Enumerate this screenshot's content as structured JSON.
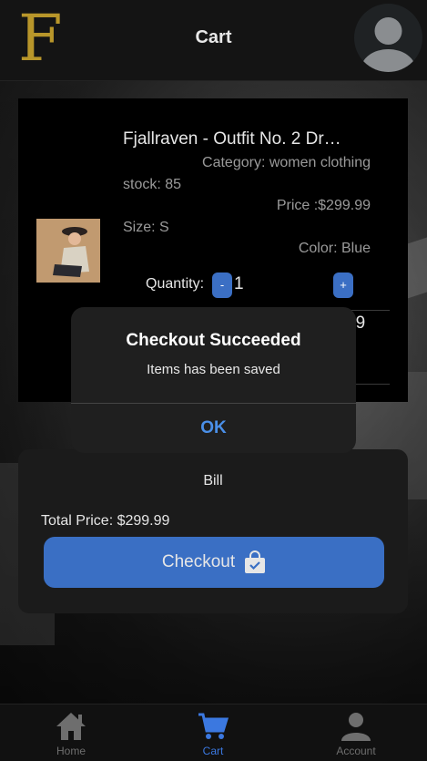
{
  "header": {
    "logo_letter": "F",
    "title": "Cart"
  },
  "product": {
    "title": "Fjallraven - Outfit No. 2 Dr…",
    "category": "Category: women clothing",
    "stock": "stock: 85",
    "price": "Price :$299.99",
    "size": "Size: S",
    "color": "Color: Blue",
    "quantity_label": "Quantity:",
    "quantity_value": "1",
    "decrement_label": "-",
    "increment_label": "+",
    "subtotal_partial": "99"
  },
  "dialog": {
    "title": "Checkout Succeeded",
    "message": "Items has been saved",
    "ok_label": "OK"
  },
  "bill": {
    "title": "Bill",
    "total": "Total Price: $299.99",
    "checkout_label": "Checkout"
  },
  "nav": {
    "items": [
      {
        "label": "Home",
        "icon": "home-icon"
      },
      {
        "label": "Cart",
        "icon": "cart-icon",
        "active": true
      },
      {
        "label": "Account",
        "icon": "account-icon"
      }
    ]
  },
  "colors": {
    "accent": "#3b6fc4",
    "logo_gold": "#b8962a",
    "dialog_ok": "#4a8fe8"
  }
}
